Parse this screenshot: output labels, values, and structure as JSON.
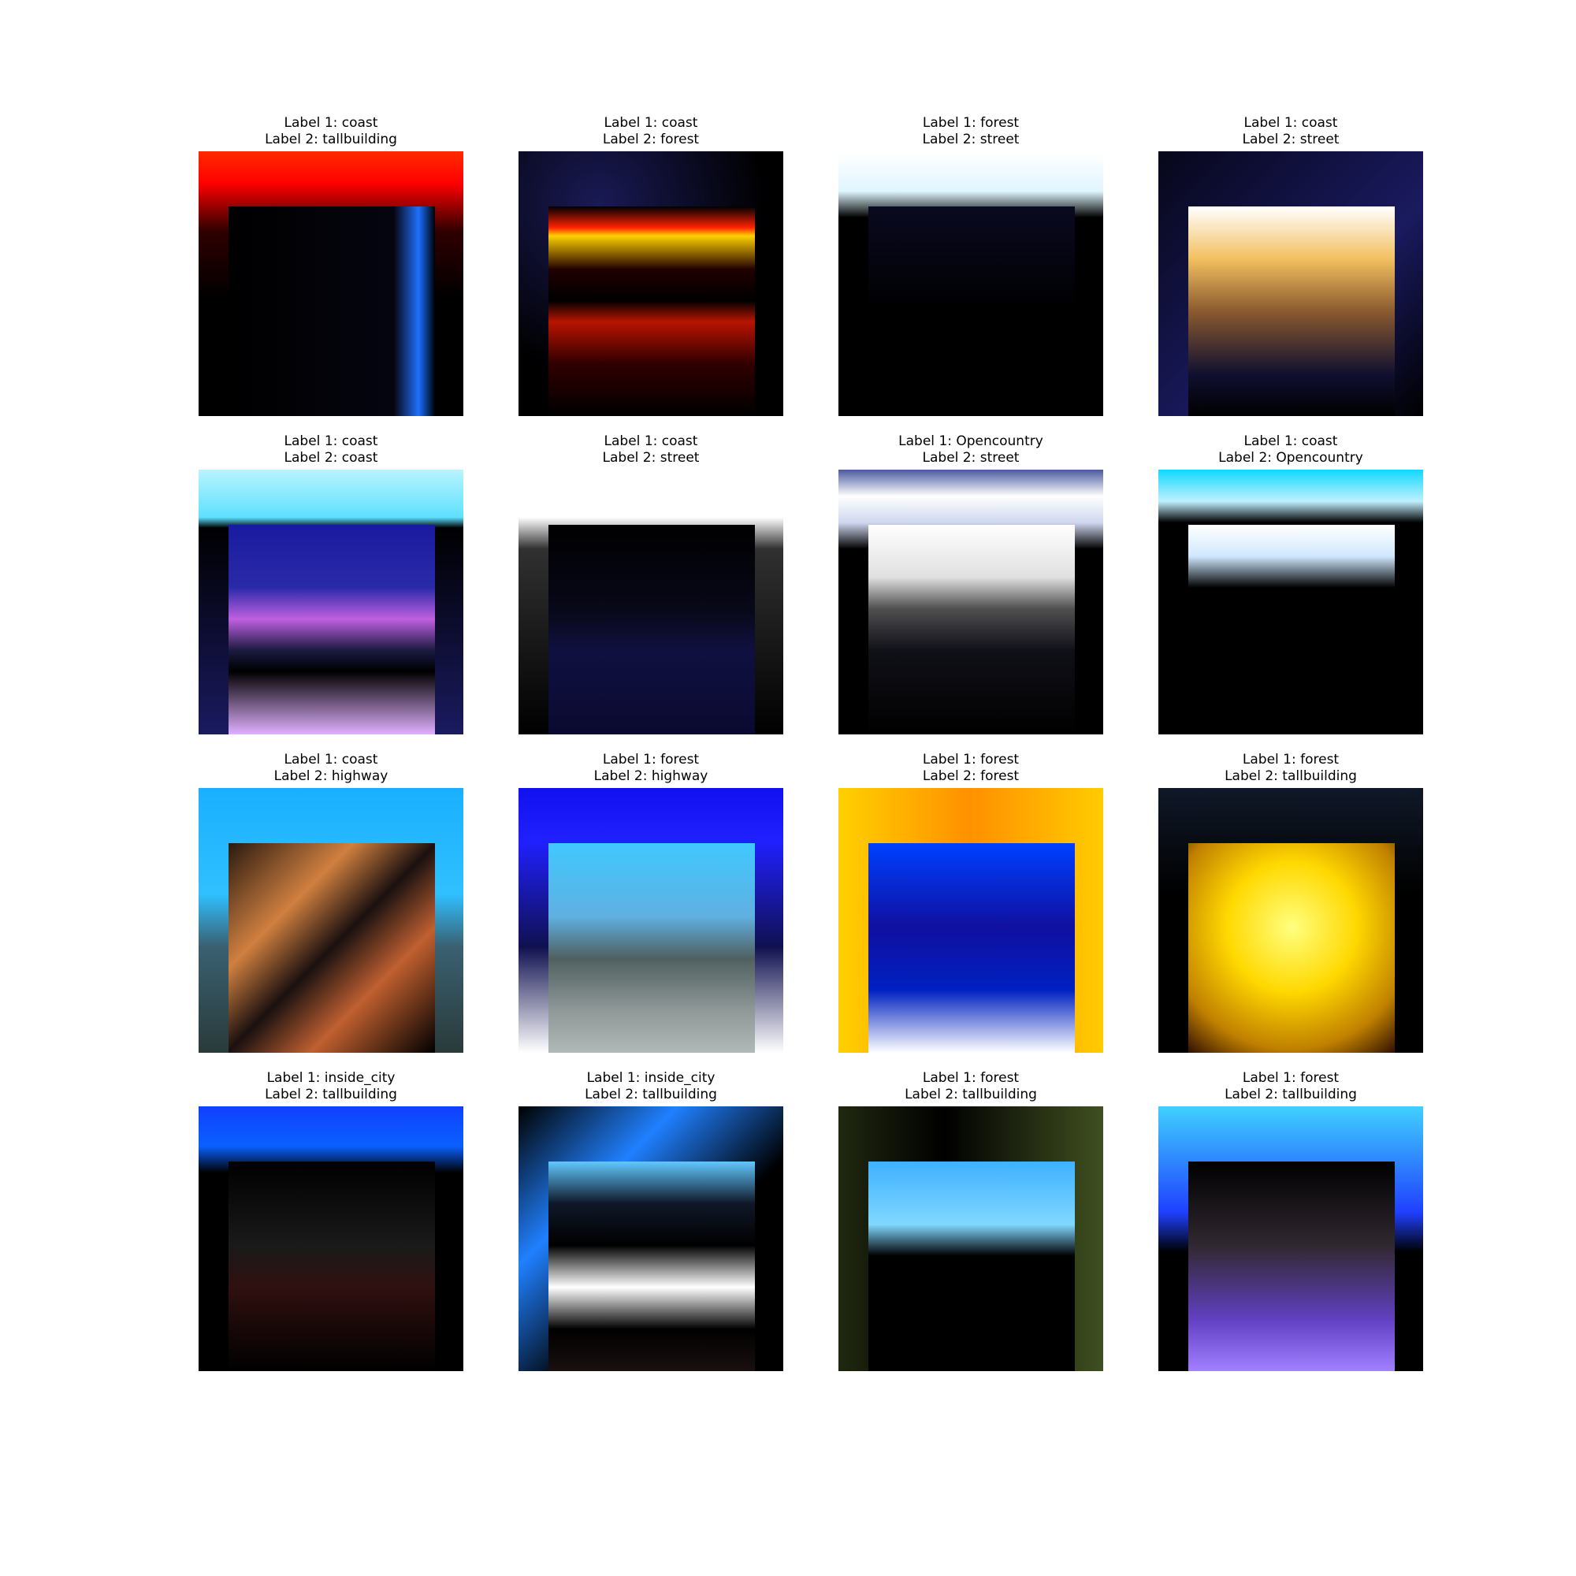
{
  "panels": [
    {
      "label1": "Label 1: coast",
      "label2": "Label 2: tallbuilding",
      "outer_bg": "linear-gradient(#ff2a00 0%, #ff0000 12%, #300000 30%, #000 55%, #000 100%)",
      "inner_bg": "linear-gradient(90deg, #000 0%, #050510 80%, #1e6fff 92%, #000 100%)"
    },
    {
      "label1": "Label 1: coast",
      "label2": "Label 2: forest",
      "outer_bg": "radial-gradient(circle at 30% 20%, #1a1a55 0%, #000 60%)",
      "inner_bg": "linear-gradient(#000 0%, #ff2000 10%, #ffd000 14%, #200000 30%, #000 45%, #b81400 55%, #300000 75%, #000 100%)"
    },
    {
      "label1": "Label 1: forest",
      "label2": "Label 2: street",
      "outer_bg": "linear-gradient(#ffffff 0%, #e0f6ff 15%, #000 25%, #000 100%)",
      "inner_bg": "linear-gradient(#0a0a20 0%, #000 50%, #000 100%)"
    },
    {
      "label1": "Label 1: coast",
      "label2": "Label 2: street",
      "outer_bg": "linear-gradient(135deg, #07071a 0%, #1a1a60 60%, #000 100%)",
      "inner_bg": "linear-gradient(#ffffff 0%, #f2c060 25%, #8a5a30 50%, #101030 80%, #000 100%)"
    },
    {
      "label1": "Label 1: coast",
      "label2": "Label 2: coast",
      "outer_bg": "linear-gradient(#b8f4ff 0%, #5ee0ff 18%, #000 22%, #1a1a60 100%)",
      "inner_bg": "linear-gradient(#1a1aa0 0%, #2a2aa8 30%, #c060e0 45%, #1a1a40 60%, #000 70%, #e0b0ff 100%)"
    },
    {
      "label1": "Label 1: coast",
      "label2": "Label 2: street",
      "outer_bg": "linear-gradient(#ffffff 0%, #ffffff 18%, #303030 30%, #000 100%)",
      "inner_bg": "linear-gradient(#000 0%, #080818 40%, #101040 60%, #0a0a30 100%)"
    },
    {
      "label1": "Label 1: Opencountry",
      "label2": "Label 2: street",
      "outer_bg": "linear-gradient(#4a5aa0 0%, #ffffff 10%, #d0d8f0 20%, #000 30%, #000 100%)",
      "inner_bg": "linear-gradient(#ffffff 0%, #e0e0e0 25%, #505050 40%, #101018 60%, #000 100%)"
    },
    {
      "label1": "Label 1: coast",
      "label2": "Label 2: Opencountry",
      "outer_bg": "linear-gradient(#10d8ff 0%, #c0f0ff 12%, #000 20%, #000 100%)",
      "inner_bg": "linear-gradient(#ffffff 0%, #d0e8ff 15%, #000 30%, #000 100%)"
    },
    {
      "label1": "Label 1: coast",
      "label2": "Label 2: highway",
      "outer_bg": "linear-gradient(#1ab0ff 0%, #30c0ff 40%, #3a6070 60%, #2a3a3a 100%)",
      "inner_bg": "linear-gradient(135deg, #2a1a10 0%, #d08040 30%, #1a1010 50%, #c06030 70%, #000 100%)"
    },
    {
      "label1": "Label 1: forest",
      "label2": "Label 2: highway",
      "outer_bg": "linear-gradient(#1010f0 0%, #2020ff 20%, #101050 60%, #ffffff 100%)",
      "inner_bg": "linear-gradient(#40c8ff 0%, #60b0e0 35%, #506060 55%, #909898 80%, #b0b8b8 100%)"
    },
    {
      "label1": "Label 1: forest",
      "label2": "Label 2: forest",
      "outer_bg": "linear-gradient(90deg, #ffd000 0%, #ff9000 50%, #ffcc00 100%)",
      "inner_bg": "linear-gradient(#0040ff 0%, #1010a0 40%, #0020c0 70%, #ffffff 100%)"
    },
    {
      "label1": "Label 1: forest",
      "label2": "Label 2: tallbuilding",
      "outer_bg": "linear-gradient(#101828 0%, #000 40%, #000 100%)",
      "inner_bg": "radial-gradient(circle at 50% 40%, #ffff80 0%, #ffd800 40%, #c08000 75%, #301000 100%)"
    },
    {
      "label1": "Label 1: inside_city",
      "label2": "Label 2: tallbuilding",
      "outer_bg": "linear-gradient(#1040ff 0%, #0a60ff 15%, #000 25%, #000 100%)",
      "inner_bg": "linear-gradient(#000 0%, #1a1a1a 40%, #301010 60%, #000 100%)"
    },
    {
      "label1": "Label 1: inside_city",
      "label2": "Label 2: tallbuilding",
      "outer_bg": "linear-gradient(135deg, #000 0%, #2080ff 30%, #000 60%, #000 100%)",
      "inner_bg": "linear-gradient(#60c8ff 0%, #101828 20%, #000 40%, #ffffff 60%, #000 80%, #1a1010 100%)"
    },
    {
      "label1": "Label 1: forest",
      "label2": "Label 2: tallbuilding",
      "outer_bg": "linear-gradient(90deg, #202810 0%, #000 40%, #405020 100%)",
      "inner_bg": "linear-gradient(#40b0ff 0%, #80d8ff 30%, #000 45%, #000 100%)"
    },
    {
      "label1": "Label 1: forest",
      "label2": "Label 2: tallbuilding",
      "outer_bg": "linear-gradient(#40d0ff 0%, #2040ff 40%, #000 55%, #000 100%)",
      "inner_bg": "linear-gradient(#000 0%, #302830 40%, #6040c0 75%, #a080ff 100%)"
    }
  ]
}
